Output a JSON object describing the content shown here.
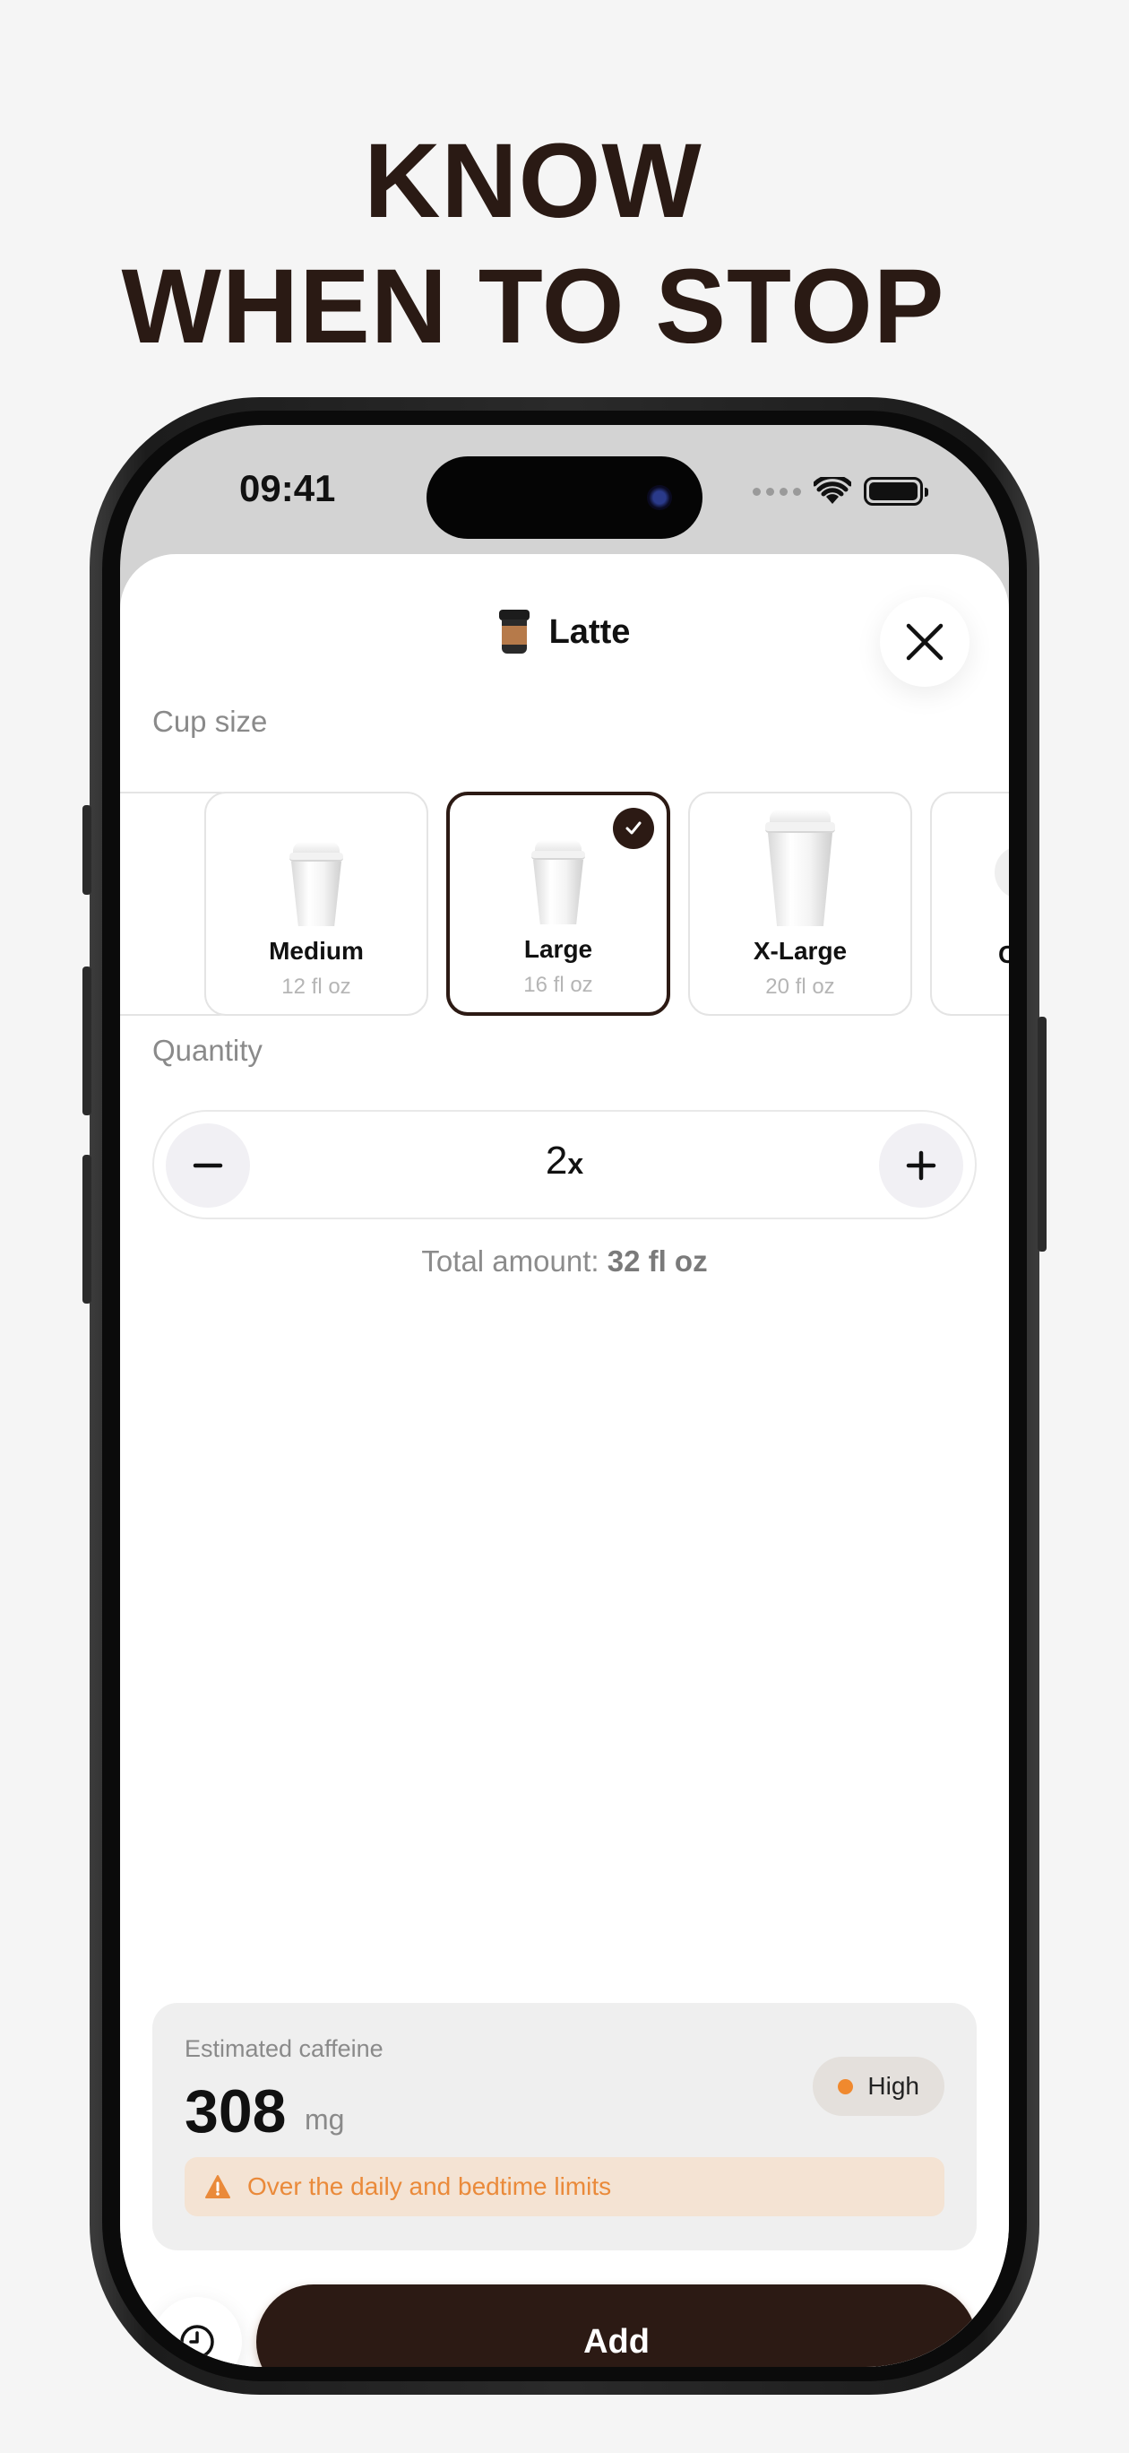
{
  "headline": {
    "line1": "KNOW",
    "line2": "WHEN TO STOP"
  },
  "status_bar": {
    "time": "09:41"
  },
  "sheet": {
    "title": "Latte",
    "title_icon": "takeaway-coffee-cup",
    "close_icon": "close-x"
  },
  "cup_size": {
    "label": "Cup size",
    "options": [
      {
        "name": "Medium",
        "volume": "12 fl oz",
        "selected": false
      },
      {
        "name": "Large",
        "volume": "16 fl oz",
        "selected": true
      },
      {
        "name": "X-Large",
        "volume": "20 fl oz",
        "selected": false
      }
    ],
    "partial_next_initial": "C"
  },
  "quantity": {
    "label": "Quantity",
    "value": "2",
    "suffix": "x"
  },
  "total": {
    "label": "Total amount:",
    "value": "32 fl oz"
  },
  "caffeine": {
    "label": "Estimated caffeine",
    "value": "308",
    "unit": "mg",
    "level": "High",
    "level_color": "#f0892e",
    "warning": "Over the daily and bedtime limits"
  },
  "actions": {
    "add_label": "Add",
    "history_icon": "clock"
  },
  "colors": {
    "brand_dark": "#2c1a14",
    "warning_orange": "#ea8a3a",
    "warning_bg": "#f4e3d3"
  }
}
